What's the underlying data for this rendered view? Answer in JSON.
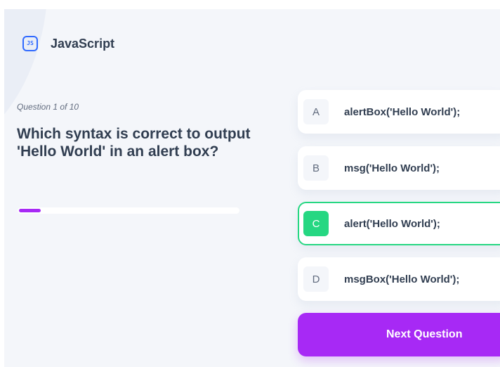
{
  "subject": {
    "icon": "javascript-icon",
    "icon_text": "JS",
    "title": "JavaScript"
  },
  "question": {
    "count_label": "Question 1 of 10",
    "current": 1,
    "total": 10,
    "text": "Which syntax is correct to output 'Hello World' in an alert box?"
  },
  "progress": {
    "fraction": 0.1
  },
  "options": [
    {
      "letter": "A",
      "text": "alertBox('Hello World');",
      "state": "default"
    },
    {
      "letter": "B",
      "text": "msg('Hello World');",
      "state": "default"
    },
    {
      "letter": "C",
      "text": "alert('Hello World');",
      "state": "selected-correct"
    },
    {
      "letter": "D",
      "text": "msgBox('Hello World');",
      "state": "default"
    }
  ],
  "next_button": {
    "label": "Next Question"
  },
  "colors": {
    "accent": "#a729f5",
    "correct": "#26d782",
    "icon_blue": "#306aff",
    "text_dark": "#313e51",
    "text_muted": "#626c7f",
    "background": "#f4f6fa"
  }
}
